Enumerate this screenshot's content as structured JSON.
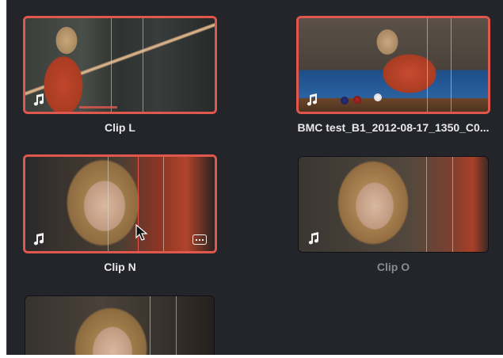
{
  "clips": [
    {
      "label": "Clip L",
      "selected": true,
      "audio_icon": "music-note-icon"
    },
    {
      "label": "BMC test_B1_2012-08-17_1350_C0...",
      "selected": true,
      "audio_icon": "music-note-icon"
    },
    {
      "label": "Clip N",
      "selected": true,
      "audio_icon": "music-note-icon",
      "extra_icon": "more-options-icon"
    },
    {
      "label": "Clip O",
      "selected": false,
      "audio_icon": "music-note-icon"
    },
    {
      "label": "",
      "selected": false
    }
  ],
  "colors": {
    "panel_bg": "#24252a",
    "selection": "#e0574e",
    "label": "#e8e8e8",
    "label_dim": "#8a8b8f"
  }
}
